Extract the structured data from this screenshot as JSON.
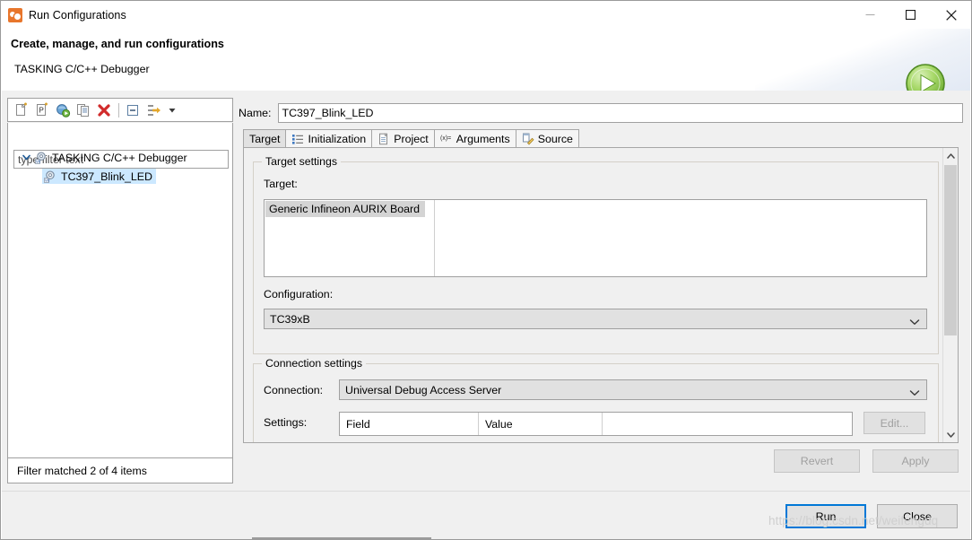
{
  "window": {
    "title": "Run Configurations",
    "icon": "run-configurations-icon",
    "minimize_label": "—",
    "maximize_label": "□",
    "close_label": "✕"
  },
  "header": {
    "title": "Create, manage, and run configurations",
    "subtitle": "TASKING C/C++ Debugger",
    "run_orb_icon": "play-orb-icon"
  },
  "left_panel": {
    "toolbar": [
      {
        "name": "new-configuration-icon",
        "tooltip": "New launch configuration"
      },
      {
        "name": "new-prototype-icon",
        "tooltip": "New prototype"
      },
      {
        "name": "export-icon",
        "tooltip": "Export"
      },
      {
        "name": "duplicate-icon",
        "tooltip": "Duplicate"
      },
      {
        "name": "delete-icon",
        "tooltip": "Delete"
      },
      {
        "name": "collapse-all-icon",
        "tooltip": "Collapse All"
      },
      {
        "name": "filter-icon",
        "tooltip": "Filter launch configurations"
      }
    ],
    "filter": {
      "placeholder": "type filter text",
      "value": ""
    },
    "tree": [
      {
        "label": "TASKING C/C++ Debugger",
        "level": 0,
        "expanded": true,
        "selected": false
      },
      {
        "label": "TC397_Blink_LED",
        "level": 1,
        "expanded": false,
        "selected": true
      }
    ],
    "status": "Filter matched 2 of 4 items"
  },
  "right_panel": {
    "name_label": "Name:",
    "name_value": "TC397_Blink_LED",
    "tabs": [
      {
        "label": "Target",
        "icon": "target-icon",
        "active": true
      },
      {
        "label": "Initialization",
        "icon": "list-icon",
        "active": false
      },
      {
        "label": "Project",
        "icon": "document-icon",
        "active": false
      },
      {
        "label": "Arguments",
        "icon": "variable-icon",
        "active": false
      },
      {
        "label": "Source",
        "icon": "source-edit-icon",
        "active": false
      }
    ],
    "target_settings": {
      "group_title": "Target settings",
      "target_label": "Target:",
      "target_items": [
        "Generic Infineon AURIX Board"
      ],
      "target_selected": "Generic Infineon AURIX Board",
      "configuration_label": "Configuration:",
      "configuration_value": "TC39xB"
    },
    "connection_settings": {
      "group_title": "Connection settings",
      "connection_label": "Connection:",
      "connection_value": "Universal Debug Access Server",
      "settings_label": "Settings:",
      "table_headers": [
        "Field",
        "Value",
        ""
      ],
      "table_rows": [],
      "edit_button": "Edit...",
      "edit_button_disabled": true
    },
    "revert_button": "Revert",
    "revert_disabled": true,
    "apply_button": "Apply",
    "apply_disabled": true
  },
  "footer": {
    "run_button": "Run",
    "close_button": "Close",
    "default_button": "Run"
  },
  "watermark": "https://blog.csdn.net/weifengdq",
  "colors": {
    "accent_blue": "#0078d7",
    "selection_blue": "#cce8ff",
    "list_selection_gray": "#d4d4d4",
    "title_icon_orange": "#e8762c",
    "run_orb_green": "#7ac142",
    "panel_bg": "#f0f0f0",
    "border_gray": "#a0a0a0"
  }
}
